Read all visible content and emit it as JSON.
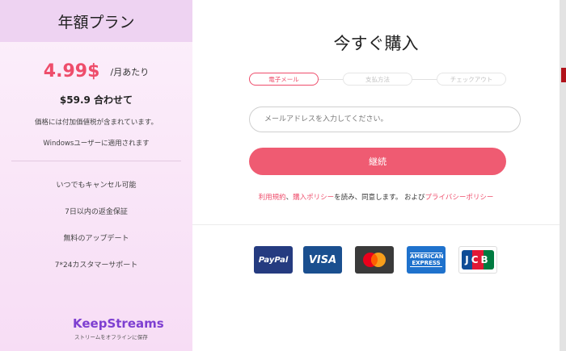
{
  "plan": {
    "title": "年額プラン",
    "price": "4.99$",
    "price_unit": "/月あたり",
    "total": "$59.9 合わせて",
    "tax_note": "価格には付加価値税が含まれています。",
    "platform_note": "Windowsユーザーに適用されます",
    "features": [
      "いつでもキャンセル可能",
      "7日以内の返金保証",
      "無料のアップデート",
      "7*24カスタマーサポート"
    ],
    "logo_text": "KeepStreams",
    "logo_sub": "ストリームをオフラインに保存"
  },
  "checkout": {
    "title": "今すぐ購入",
    "steps": [
      "電子メール",
      "支払方法",
      "チェックアウト"
    ],
    "email_placeholder": "メールアドレスを入力してください。",
    "continue_label": "継続",
    "terms": {
      "link1": "利用規約",
      "sep1": "、",
      "link2": "購入ポリシー",
      "mid": "を読み、同意します。 および",
      "link3": "プライバシーポリシー"
    },
    "payment_methods": [
      {
        "name": "paypal-icon",
        "label": "PayPal",
        "color": "#253b80"
      },
      {
        "name": "visa-icon",
        "label": "VISA",
        "color": "#1a4f8f"
      },
      {
        "name": "mastercard-icon",
        "label": "",
        "color": "#3a3a3a"
      },
      {
        "name": "american-express-icon",
        "label": "AMERICAN EXPRESS",
        "color": "#1f72cd"
      },
      {
        "name": "jcb-icon",
        "label": "JCB",
        "color": "#ffffff"
      }
    ]
  },
  "colors": {
    "accent": "#ee4d6b",
    "plan_bg": "#fcf0fb",
    "header_bg": "#eed3f2",
    "brand": "#7e3fd1"
  }
}
